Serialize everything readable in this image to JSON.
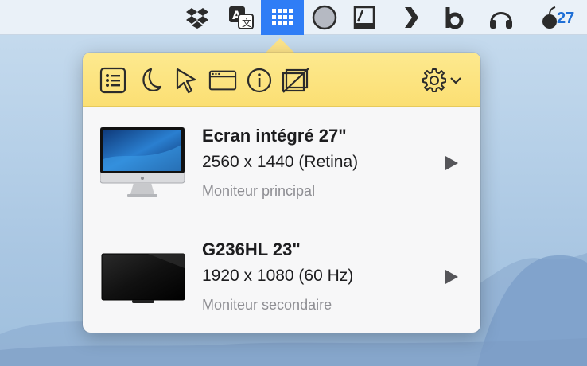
{
  "menubar": {
    "icons": [
      "dropbox-icon",
      "translate-icon",
      "display-grid-icon",
      "circle-icon",
      "disk-icon",
      "chevron-right-icon",
      "b-icon",
      "headphones-icon",
      "badge-icon"
    ],
    "badge_count": "27",
    "active_color": "#2f7df6"
  },
  "toolbar": {
    "icons": [
      "list-icon",
      "moon-icon",
      "cursor-icon",
      "window-icon",
      "info-icon",
      "no-display-icon",
      "gear-icon"
    ],
    "accent": "#fbdf73"
  },
  "displays": [
    {
      "name": "Ecran intégré 27\"",
      "resolution": "2560 x 1440 (Retina)",
      "role": "Moniteur principal"
    },
    {
      "name": "G236HL 23\"",
      "resolution": "1920 x 1080 (60 Hz)",
      "role": "Moniteur secondaire"
    }
  ]
}
